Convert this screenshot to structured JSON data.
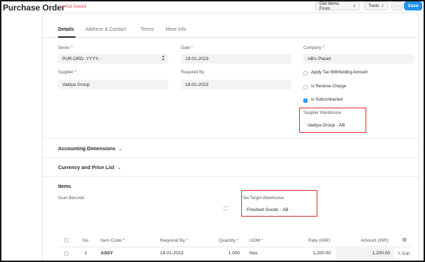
{
  "header": {
    "title": "Purchase Order",
    "status": "Not Saved",
    "get_items_label": "Get Items From",
    "tools_label": "Tools",
    "more_label": "···",
    "save_label": "Save"
  },
  "tabs": [
    {
      "label": "Details"
    },
    {
      "label": "Address & Contact"
    },
    {
      "label": "Terms"
    },
    {
      "label": "More Info"
    }
  ],
  "form": {
    "series": {
      "label": "Series",
      "value": "PUR-ORD-.YYYY.-"
    },
    "date": {
      "label": "Date",
      "value": "19-01-2023"
    },
    "company": {
      "label": "Company",
      "value": "AB's Planet"
    },
    "supplier": {
      "label": "Supplier",
      "value": "Vaidya Group"
    },
    "required_by": {
      "label": "Required By",
      "value": "19-01-2023"
    },
    "apply_tds": {
      "label": "Apply Tax Withholding Amount",
      "checked": false
    },
    "reverse_charge": {
      "label": "Is Reverse Charge",
      "checked": false
    },
    "subcontracted": {
      "label": "Is Subcontracted",
      "checked": true
    },
    "supplier_warehouse": {
      "label": "Supplier Warehouse",
      "value": "Vaidya Group - AB"
    }
  },
  "sections": {
    "accounting": "Accounting Dimensions",
    "currency": "Currency and Price List",
    "items": "Items"
  },
  "items_section": {
    "scan_barcode_label": "Scan Barcode",
    "set_target_warehouse_label": "Set Target Warehouse",
    "set_target_warehouse_value": "Finished Goods - AB"
  },
  "table": {
    "headers": {
      "no": "No.",
      "item_code": "Item Code",
      "required_by": "Required By",
      "quantity": "Quantity",
      "uom": "UOM",
      "rate": "Rate (INR)",
      "amount": "Amount (INR)"
    },
    "rows": [
      {
        "no": "1",
        "item_code": "ASSY",
        "required_by": "19-01-2023",
        "quantity": "1.000",
        "uom": "Nos",
        "rate": "1,200.00",
        "amount": "1,200.00",
        "edit": "Edit"
      }
    ]
  },
  "colors": {
    "primary": "#2490ef",
    "required": "#e24c4c",
    "highlight_box": "#d92929"
  }
}
